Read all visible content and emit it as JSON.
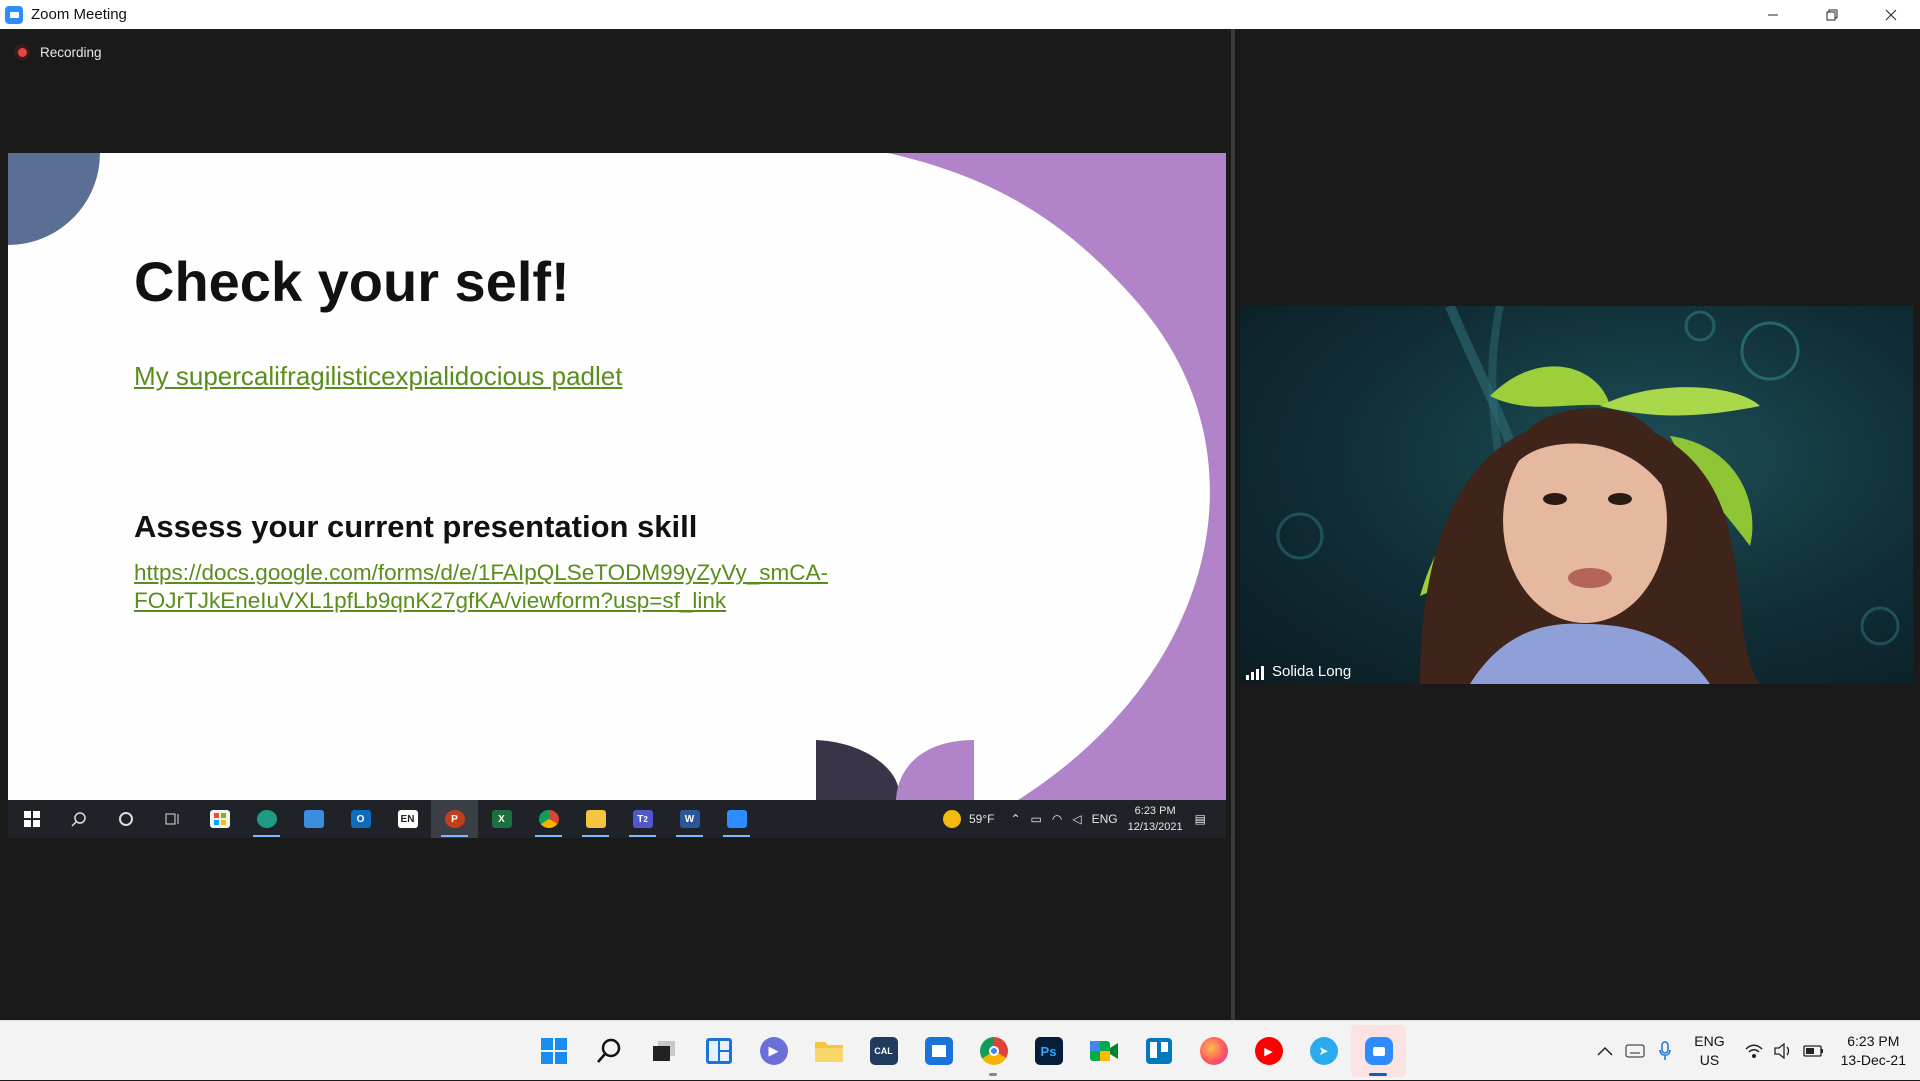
{
  "window": {
    "title": "Zoom Meeting",
    "controls": [
      "minimize",
      "restore",
      "close"
    ]
  },
  "recording": {
    "label": "Recording",
    "color": "#e8453c"
  },
  "slide": {
    "title": "Check your self!",
    "link1": "My supercalifragilisticexpialidocious padlet",
    "subtitle": "Assess your current presentation skill",
    "link2": "https://docs.google.com/forms/d/e/1FAIpQLSeTODM99yZyVy_smCA-FOJrTJkEneIuVXL1pfLb9qnK27gfKA/viewform?usp=sf_link",
    "colors": {
      "accent_purple": "#b184c9",
      "navy": "#5b6e94",
      "dark": "#3b3347",
      "link": "#5a8e1c"
    }
  },
  "inner_taskbar": {
    "icons": [
      "windows-start-icon",
      "search-icon",
      "cortana-icon",
      "task-view-icon",
      "store-icon",
      "edge-icon",
      "mail-icon",
      "outlook-icon",
      "en-icon",
      "powerpoint-icon",
      "excel-icon",
      "chrome-icon",
      "file-explorer-icon",
      "teams-icon",
      "word-icon",
      "zoom-icon"
    ],
    "en_label": "EN",
    "teams_badge": "2",
    "weather": "59°F",
    "lang": "ENG",
    "time": "6:23 PM",
    "date": "12/13/2021"
  },
  "participant": {
    "name": "Solida Long"
  },
  "taskbar": {
    "apps": [
      "start-icon",
      "search-icon",
      "task-view-icon",
      "widgets-icon",
      "chat-icon",
      "file-explorer-icon",
      "calendar-app-icon",
      "outlook-calendar-icon",
      "chrome-icon",
      "photoshop-icon",
      "google-meet-icon",
      "trello-icon",
      "firefox-icon",
      "youtube-music-icon",
      "telegram-icon",
      "zoom-icon"
    ],
    "calendar_label": "CAL",
    "photoshop_label": "Ps",
    "lang_top": "ENG",
    "lang_bottom": "US",
    "time": "6:23 PM",
    "date": "13-Dec-21"
  }
}
